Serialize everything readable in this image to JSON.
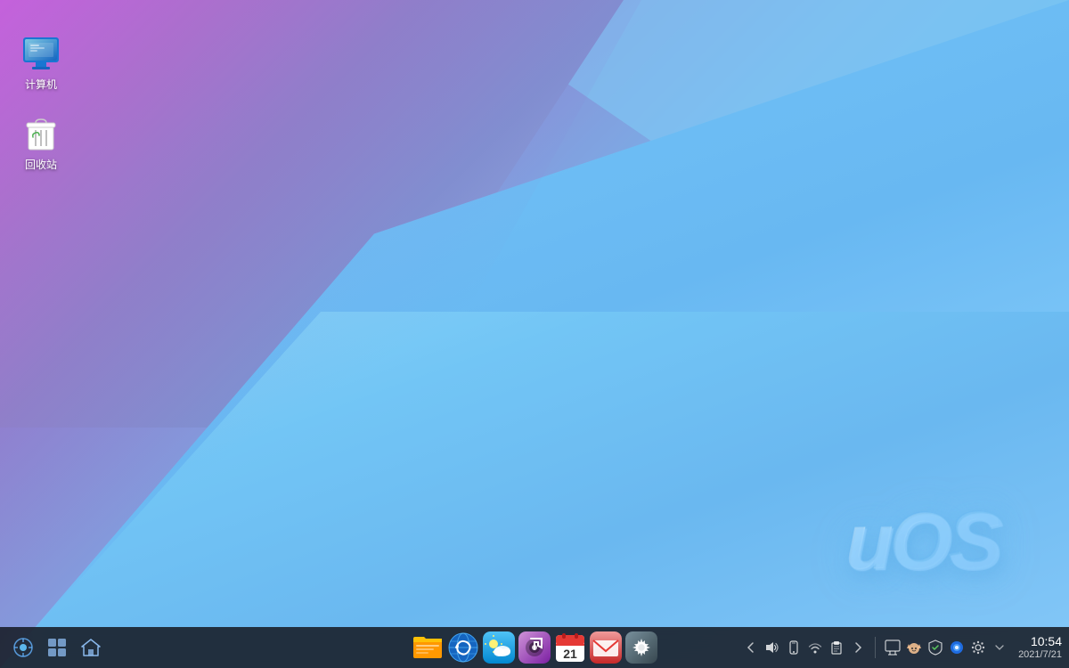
{
  "desktop": {
    "icons": [
      {
        "id": "computer",
        "label": "计算机",
        "type": "computer"
      },
      {
        "id": "recycle",
        "label": "回收站",
        "type": "trash"
      }
    ],
    "uos_logo": "uOS"
  },
  "taskbar": {
    "left": [
      {
        "id": "launcher",
        "label": "启动器",
        "icon": "⊞"
      },
      {
        "id": "multitask",
        "label": "多任务视图",
        "icon": "⧉"
      },
      {
        "id": "dde-home",
        "label": "DDE主页",
        "icon": "⌂"
      }
    ],
    "center": [
      {
        "id": "files",
        "label": "文件管理器",
        "icon": "📁"
      },
      {
        "id": "browser",
        "label": "浏览器",
        "icon": "🌐"
      },
      {
        "id": "weather",
        "label": "天气",
        "icon": "⛅"
      },
      {
        "id": "music",
        "label": "音乐",
        "icon": "♪"
      },
      {
        "id": "calendar",
        "label": "日历",
        "icon": "21"
      },
      {
        "id": "email",
        "label": "邮件",
        "icon": "✉"
      },
      {
        "id": "settings",
        "label": "设置",
        "icon": "⚙"
      }
    ],
    "tray": [
      {
        "id": "tray-expand",
        "icon": "◀",
        "label": "展开"
      },
      {
        "id": "tray-vol",
        "icon": "🔊",
        "label": "音量"
      },
      {
        "id": "tray-phone",
        "icon": "📱",
        "label": "手机"
      },
      {
        "id": "tray-net",
        "icon": "📶",
        "label": "网络"
      },
      {
        "id": "tray-clipboard",
        "icon": "📋",
        "label": "剪贴板"
      },
      {
        "id": "tray-more",
        "icon": "▶",
        "label": "更多"
      },
      {
        "id": "tray-sep",
        "type": "separator"
      },
      {
        "id": "tray-app1",
        "icon": "🖥",
        "label": "应用1"
      },
      {
        "id": "tray-app2",
        "icon": "😺",
        "label": "应用2"
      },
      {
        "id": "tray-app3",
        "icon": "🔒",
        "label": "安全"
      },
      {
        "id": "tray-app4",
        "icon": "🔵",
        "label": "应用4"
      },
      {
        "id": "tray-app5",
        "icon": "⚙",
        "label": "系统"
      },
      {
        "id": "tray-expand2",
        "icon": "⇑",
        "label": "展开2"
      }
    ],
    "clock": {
      "time": "10:54",
      "date": "2021/7/21"
    }
  }
}
